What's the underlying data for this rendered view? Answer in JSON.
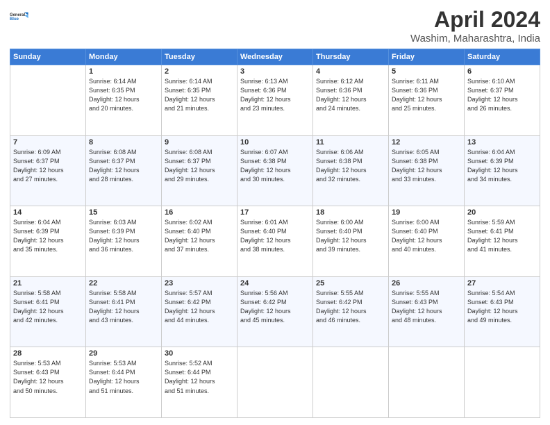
{
  "header": {
    "logo_line1": "General",
    "logo_line2": "Blue",
    "month": "April 2024",
    "location": "Washim, Maharashtra, India"
  },
  "columns": [
    "Sunday",
    "Monday",
    "Tuesday",
    "Wednesday",
    "Thursday",
    "Friday",
    "Saturday"
  ],
  "weeks": [
    [
      {
        "day": "",
        "info": ""
      },
      {
        "day": "1",
        "info": "Sunrise: 6:14 AM\nSunset: 6:35 PM\nDaylight: 12 hours\nand 20 minutes."
      },
      {
        "day": "2",
        "info": "Sunrise: 6:14 AM\nSunset: 6:35 PM\nDaylight: 12 hours\nand 21 minutes."
      },
      {
        "day": "3",
        "info": "Sunrise: 6:13 AM\nSunset: 6:36 PM\nDaylight: 12 hours\nand 23 minutes."
      },
      {
        "day": "4",
        "info": "Sunrise: 6:12 AM\nSunset: 6:36 PM\nDaylight: 12 hours\nand 24 minutes."
      },
      {
        "day": "5",
        "info": "Sunrise: 6:11 AM\nSunset: 6:36 PM\nDaylight: 12 hours\nand 25 minutes."
      },
      {
        "day": "6",
        "info": "Sunrise: 6:10 AM\nSunset: 6:37 PM\nDaylight: 12 hours\nand 26 minutes."
      }
    ],
    [
      {
        "day": "7",
        "info": "Sunrise: 6:09 AM\nSunset: 6:37 PM\nDaylight: 12 hours\nand 27 minutes."
      },
      {
        "day": "8",
        "info": "Sunrise: 6:08 AM\nSunset: 6:37 PM\nDaylight: 12 hours\nand 28 minutes."
      },
      {
        "day": "9",
        "info": "Sunrise: 6:08 AM\nSunset: 6:37 PM\nDaylight: 12 hours\nand 29 minutes."
      },
      {
        "day": "10",
        "info": "Sunrise: 6:07 AM\nSunset: 6:38 PM\nDaylight: 12 hours\nand 30 minutes."
      },
      {
        "day": "11",
        "info": "Sunrise: 6:06 AM\nSunset: 6:38 PM\nDaylight: 12 hours\nand 32 minutes."
      },
      {
        "day": "12",
        "info": "Sunrise: 6:05 AM\nSunset: 6:38 PM\nDaylight: 12 hours\nand 33 minutes."
      },
      {
        "day": "13",
        "info": "Sunrise: 6:04 AM\nSunset: 6:39 PM\nDaylight: 12 hours\nand 34 minutes."
      }
    ],
    [
      {
        "day": "14",
        "info": "Sunrise: 6:04 AM\nSunset: 6:39 PM\nDaylight: 12 hours\nand 35 minutes."
      },
      {
        "day": "15",
        "info": "Sunrise: 6:03 AM\nSunset: 6:39 PM\nDaylight: 12 hours\nand 36 minutes."
      },
      {
        "day": "16",
        "info": "Sunrise: 6:02 AM\nSunset: 6:40 PM\nDaylight: 12 hours\nand 37 minutes."
      },
      {
        "day": "17",
        "info": "Sunrise: 6:01 AM\nSunset: 6:40 PM\nDaylight: 12 hours\nand 38 minutes."
      },
      {
        "day": "18",
        "info": "Sunrise: 6:00 AM\nSunset: 6:40 PM\nDaylight: 12 hours\nand 39 minutes."
      },
      {
        "day": "19",
        "info": "Sunrise: 6:00 AM\nSunset: 6:40 PM\nDaylight: 12 hours\nand 40 minutes."
      },
      {
        "day": "20",
        "info": "Sunrise: 5:59 AM\nSunset: 6:41 PM\nDaylight: 12 hours\nand 41 minutes."
      }
    ],
    [
      {
        "day": "21",
        "info": "Sunrise: 5:58 AM\nSunset: 6:41 PM\nDaylight: 12 hours\nand 42 minutes."
      },
      {
        "day": "22",
        "info": "Sunrise: 5:58 AM\nSunset: 6:41 PM\nDaylight: 12 hours\nand 43 minutes."
      },
      {
        "day": "23",
        "info": "Sunrise: 5:57 AM\nSunset: 6:42 PM\nDaylight: 12 hours\nand 44 minutes."
      },
      {
        "day": "24",
        "info": "Sunrise: 5:56 AM\nSunset: 6:42 PM\nDaylight: 12 hours\nand 45 minutes."
      },
      {
        "day": "25",
        "info": "Sunrise: 5:55 AM\nSunset: 6:42 PM\nDaylight: 12 hours\nand 46 minutes."
      },
      {
        "day": "26",
        "info": "Sunrise: 5:55 AM\nSunset: 6:43 PM\nDaylight: 12 hours\nand 48 minutes."
      },
      {
        "day": "27",
        "info": "Sunrise: 5:54 AM\nSunset: 6:43 PM\nDaylight: 12 hours\nand 49 minutes."
      }
    ],
    [
      {
        "day": "28",
        "info": "Sunrise: 5:53 AM\nSunset: 6:43 PM\nDaylight: 12 hours\nand 50 minutes."
      },
      {
        "day": "29",
        "info": "Sunrise: 5:53 AM\nSunset: 6:44 PM\nDaylight: 12 hours\nand 51 minutes."
      },
      {
        "day": "30",
        "info": "Sunrise: 5:52 AM\nSunset: 6:44 PM\nDaylight: 12 hours\nand 51 minutes."
      },
      {
        "day": "",
        "info": ""
      },
      {
        "day": "",
        "info": ""
      },
      {
        "day": "",
        "info": ""
      },
      {
        "day": "",
        "info": ""
      }
    ]
  ]
}
